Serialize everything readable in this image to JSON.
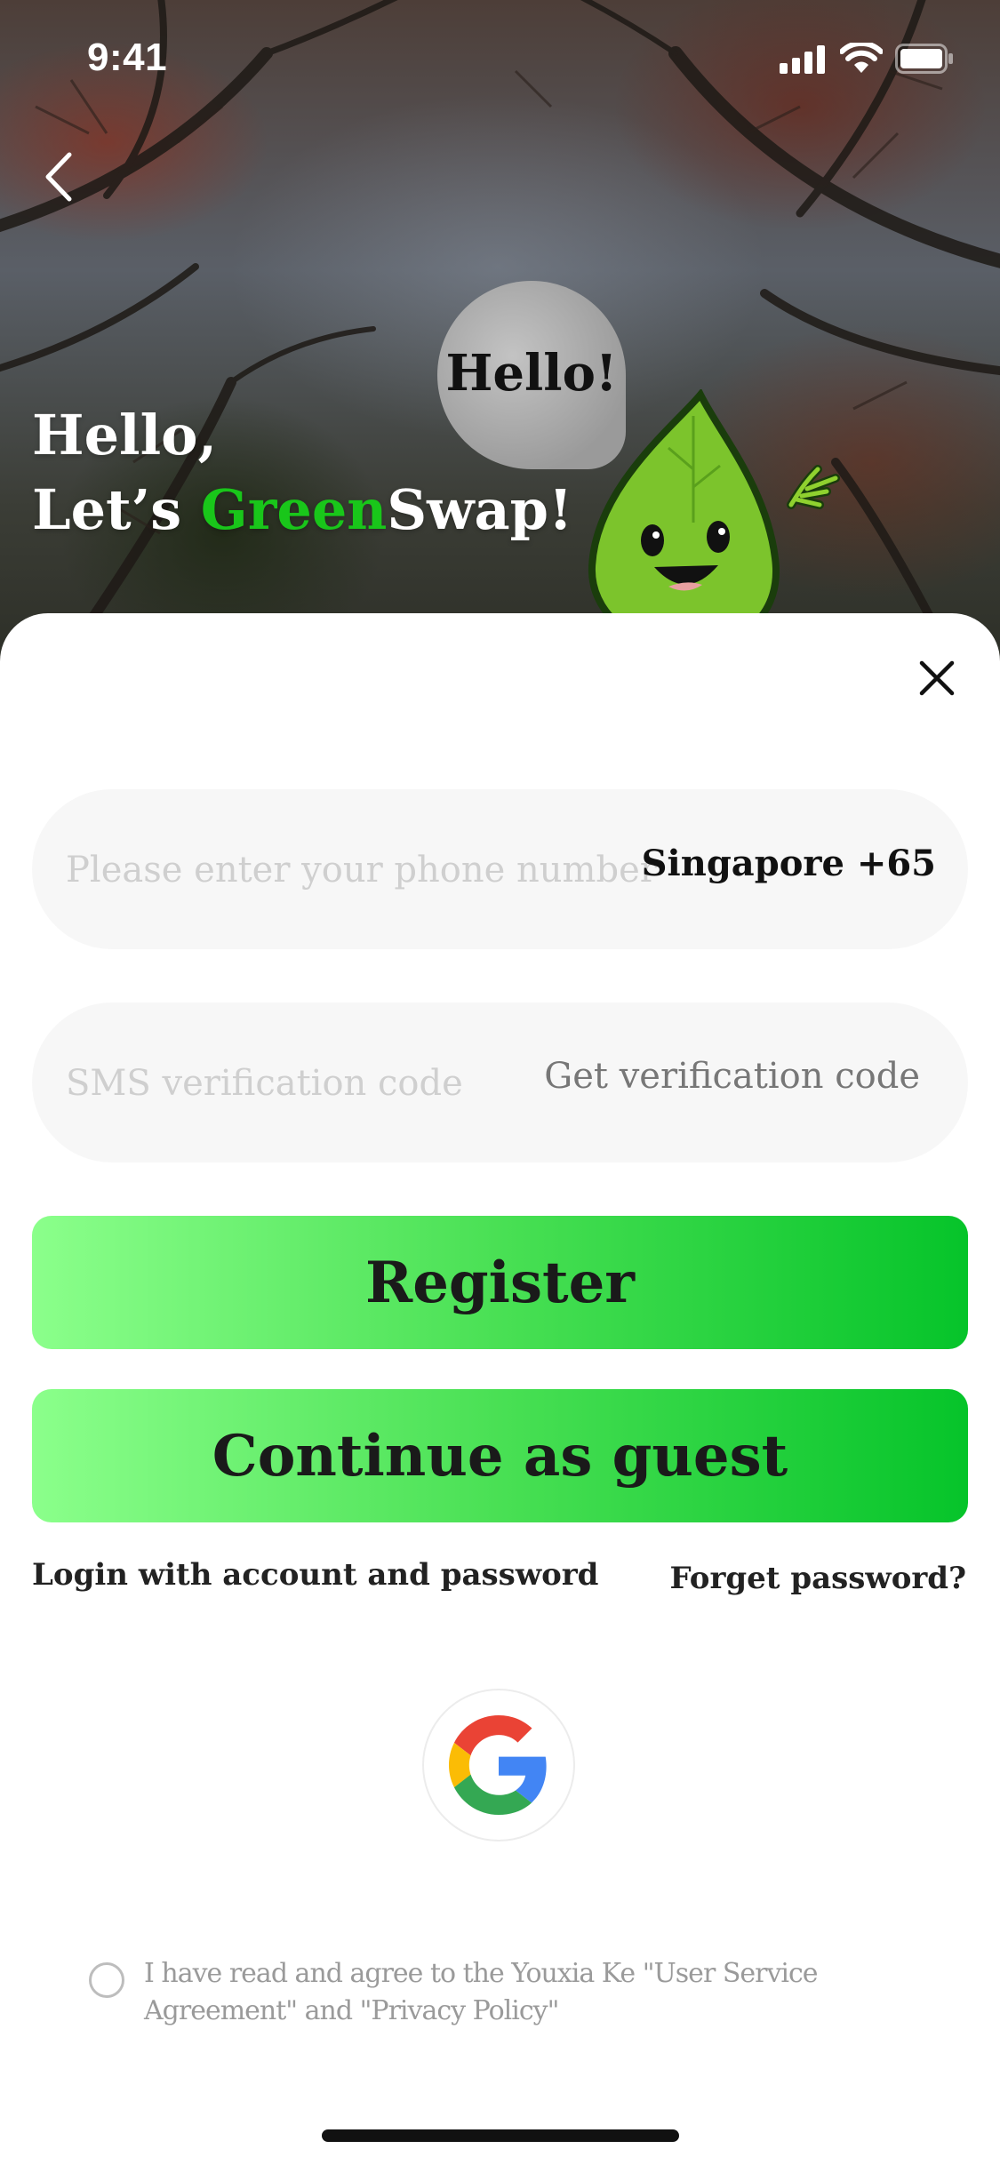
{
  "status_bar": {
    "time": "9:41"
  },
  "hero": {
    "bubble_text": "Hello!",
    "greeting_line1": "Hello,",
    "greeting_prefix": "Let’s ",
    "greeting_brand_green": "Green",
    "greeting_brand_rest": "Swap!"
  },
  "form": {
    "phone_placeholder": "Please enter your phone number",
    "country_code": "Singapore +65",
    "sms_placeholder": "SMS verification code",
    "get_code_label": "Get verification code"
  },
  "buttons": {
    "register": "Register",
    "guest": "Continue as guest"
  },
  "links": {
    "login_account": "Login with account and password",
    "forget_password": "Forget password?"
  },
  "agreement": {
    "text": "I have read and agree to the Youxia Ke \"User Service Agreement\" and \"Privacy Policy\""
  },
  "icons": {
    "back": "chevron-left-icon",
    "close": "close-icon",
    "google": "google-icon",
    "signal": "signal-icon",
    "wifi": "wifi-icon",
    "battery": "battery-icon"
  },
  "colors": {
    "brand_green": "#19c61a",
    "button_gradient_start": "#8bff8b",
    "button_gradient_end": "#06c42a"
  }
}
